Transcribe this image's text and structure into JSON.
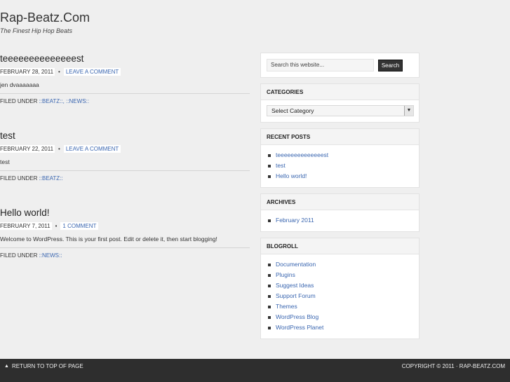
{
  "site": {
    "title": "Rap-Beatz.Com",
    "description": "The Finest Hip Hop Beats"
  },
  "posts": [
    {
      "title": "teeeeeeeeeeeeeest",
      "date": "February 28, 2011",
      "comment_link": "Leave a Comment",
      "body": "jen dvaaaaaaa",
      "filed_label": "Filed Under",
      "categories": "::BEATZ::, ::NEWS::"
    },
    {
      "title": "test",
      "date": "February 22, 2011",
      "comment_link": "Leave a Comment",
      "body": "test",
      "filed_label": "Filed Under",
      "categories": "::BEATZ::"
    },
    {
      "title": "Hello world!",
      "date": "February 7, 2011",
      "comment_link": "1 Comment",
      "body": "Welcome to WordPress. This is your first post. Edit or delete it, then start blogging!",
      "filed_label": "Filed Under",
      "categories": "::NEWS::"
    }
  ],
  "sidebar": {
    "search": {
      "value": "Search this website...",
      "button": "Search"
    },
    "categories": {
      "heading": "Categories",
      "selected": "Select Category"
    },
    "recent_posts": {
      "heading": "Recent Posts",
      "items": [
        "teeeeeeeeeeeeeest",
        "test",
        "Hello world!"
      ]
    },
    "archives": {
      "heading": "Archives",
      "items": [
        "February 2011"
      ]
    },
    "blogroll": {
      "heading": "Blogroll",
      "items": [
        "Documentation",
        "Plugins",
        "Suggest Ideas",
        "Support Forum",
        "Themes",
        "WordPress Blog",
        "WordPress Planet"
      ]
    }
  },
  "footer": {
    "back_to_top": "Return to top of page",
    "copyright": "Copyright © 2011 · Rap-Beatz.com"
  },
  "icons": {
    "back_to_top": "up-triangle-icon",
    "select_arrow": "chevron-down-icon",
    "bullet": "square-bullet-icon"
  },
  "colors": {
    "link": "#3a66b0",
    "background": "#efefef",
    "footer": "#2e2e2e"
  }
}
